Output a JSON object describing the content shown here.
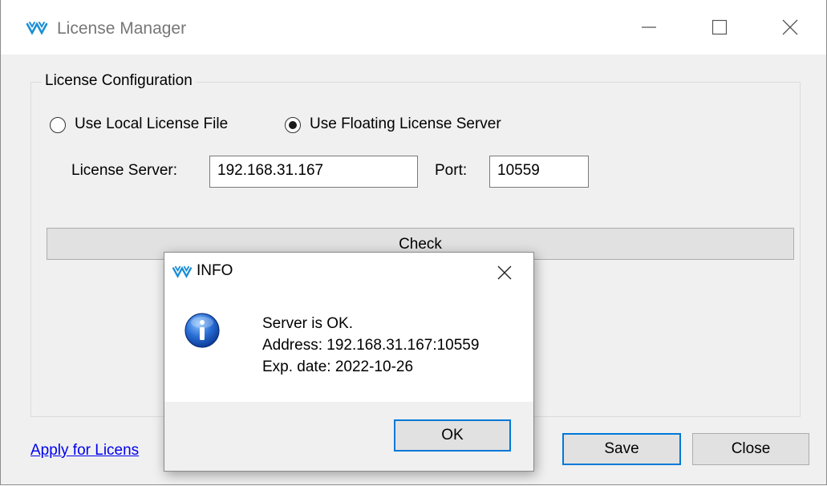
{
  "window": {
    "title": "License Manager",
    "icon": "gowin-logo-icon",
    "controls": {
      "minimize": "minimize-icon",
      "maximize": "maximize-icon",
      "close": "close-icon"
    }
  },
  "config": {
    "group_label": "License Configuration",
    "radio_local_label": "Use Local License File",
    "radio_local_selected": false,
    "radio_floating_label": "Use Floating License Server",
    "radio_floating_selected": true,
    "server_label": "License Server:",
    "server_value": "192.168.31.167",
    "port_label": "Port:",
    "port_value": "10559",
    "check_label": "Check"
  },
  "footer": {
    "apply_link": "Apply for Licens",
    "save_label": "Save",
    "close_label": "Close"
  },
  "dialog": {
    "title": "INFO",
    "icon": "info-icon",
    "lines": [
      "Server is OK.",
      "Address: 192.168.31.167:10559",
      "Exp. date: 2022-10-26"
    ],
    "ok_label": "OK"
  },
  "colors": {
    "accent": "#0078d7",
    "link": "#0000ee",
    "logo": "#1b8fd6"
  }
}
